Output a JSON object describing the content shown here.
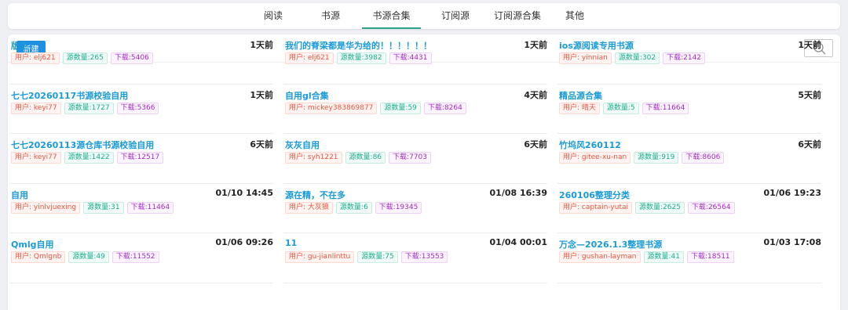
{
  "nav": {
    "tabs": [
      {
        "label": "阅读"
      },
      {
        "label": "书源"
      },
      {
        "label": "书源合集"
      },
      {
        "label": "订阅源"
      },
      {
        "label": "订阅源合集"
      },
      {
        "label": "其他"
      }
    ],
    "active_tab": "书源合集"
  },
  "toolbar": {
    "new_label": "新建",
    "search_icon": "search-icon"
  },
  "colors": {
    "accent": "#1e8fe1",
    "title": "#1a9ad6",
    "active_tab_underline": "#2aa58a",
    "user_tag": "#e8553e",
    "count_tag": "#1aad8c",
    "download_tag": "#a32cc4"
  },
  "cards": [
    {
      "title": "版主",
      "time": "1天前",
      "user": "用户: elj621",
      "count": "源数量:265",
      "downloads": "下载:5406"
    },
    {
      "title": "我们的脊梁都是华为给的！！！！！！",
      "time": "1天前",
      "user": "用户: elj621",
      "count": "源数量:3982",
      "downloads": "下载:4431"
    },
    {
      "title": "ios源阅读专用书源",
      "time": "1天前",
      "user": "用户: yinnian",
      "count": "源数量:302",
      "downloads": "下载:2142"
    },
    {
      "title": "七七20260117书源校验自用",
      "time": "1天前",
      "user": "用户: keyi77",
      "count": "源数量:1727",
      "downloads": "下载:5366"
    },
    {
      "title": "自用gl合集",
      "time": "4天前",
      "user": "用户: mickey383869877",
      "count": "源数量:59",
      "downloads": "下载:8264"
    },
    {
      "title": "精品源合集",
      "time": "5天前",
      "user": "用户: 晴天",
      "count": "源数量:5",
      "downloads": "下载:11664"
    },
    {
      "title": "七七20260113源仓库书源校验自用",
      "time": "6天前",
      "user": "用户: keyi77",
      "count": "源数量:1422",
      "downloads": "下载:12517"
    },
    {
      "title": "灰灰自用",
      "time": "6天前",
      "user": "用户: syh1221",
      "count": "源数量:86",
      "downloads": "下载:7703"
    },
    {
      "title": "竹坞风260112",
      "time": "6天前",
      "user": "用户: gitee-xu-nan",
      "count": "源数量:919",
      "downloads": "下载:8606"
    },
    {
      "title": "自用",
      "time": "01/10 14:45",
      "user": "用户: yinlvjuexing",
      "count": "源数量:31",
      "downloads": "下载:11464"
    },
    {
      "title": "源在精，不在多",
      "time": "01/08 16:39",
      "user": "用户: 大灰狼",
      "count": "源数量:6",
      "downloads": "下载:19345"
    },
    {
      "title": "260106整理分类",
      "time": "01/06 19:23",
      "user": "用户: captain-yutai",
      "count": "源数量:2625",
      "downloads": "下载:26564"
    },
    {
      "title": "Qmlg自用",
      "time": "01/06 09:26",
      "user": "用户: Qmlgnb",
      "count": "源数量:49",
      "downloads": "下载:11552"
    },
    {
      "title": "11",
      "time": "01/04 00:01",
      "user": "用户: gu-jianlinttu",
      "count": "源数量:75",
      "downloads": "下载:13553"
    },
    {
      "title": "万念—2026.1.3整理书源",
      "time": "01/03 17:08",
      "user": "用户: gushan-layman",
      "count": "源数量:41",
      "downloads": "下载:18511"
    }
  ]
}
